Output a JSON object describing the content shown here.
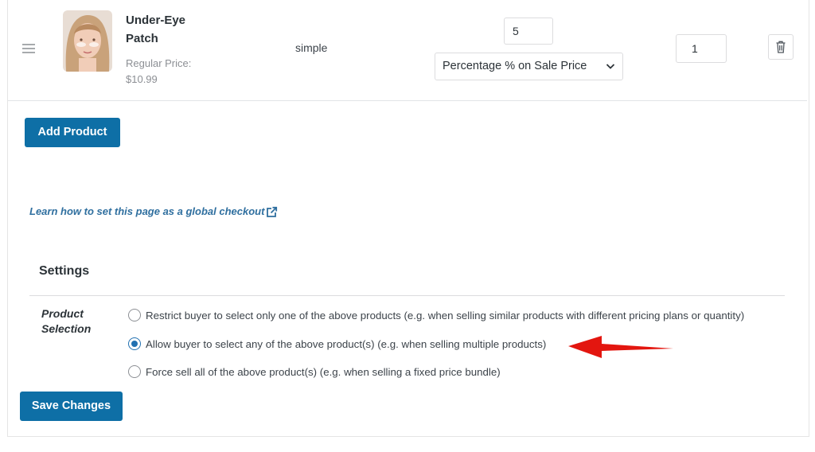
{
  "product": {
    "name_line1": "Under-Eye",
    "name_line2": "Patch",
    "price_label": "Regular Price:",
    "price_value": "$10.99",
    "type": "simple",
    "discount_value": "5",
    "discount_type": "Percentage % on Sale Price",
    "quantity": "1"
  },
  "actions": {
    "add_product": "Add Product",
    "save_changes": "Save Changes"
  },
  "learn_link": "Learn how to set this page as a global checkout",
  "settings": {
    "title": "Settings",
    "field_label_line1": "Product",
    "field_label_line2": "Selection",
    "options": [
      {
        "label": "Restrict buyer to select only one of the above products (e.g. when selling similar products with different pricing plans or quantity)",
        "checked": false
      },
      {
        "label": "Allow buyer to select any of the above product(s) (e.g. when selling multiple products)",
        "checked": true
      },
      {
        "label": "Force sell all of the above product(s) (e.g. when selling a fixed price bundle)",
        "checked": false
      }
    ]
  },
  "colors": {
    "primary_button": "#0e6fa6",
    "link": "#2f6f9f",
    "radio_checked": "#2271b1",
    "annotation_arrow": "#e3160f"
  },
  "icons": [
    "drag-handle-icon",
    "chevron-down-icon",
    "trash-icon",
    "external-link-icon",
    "red-arrow-annotation"
  ]
}
